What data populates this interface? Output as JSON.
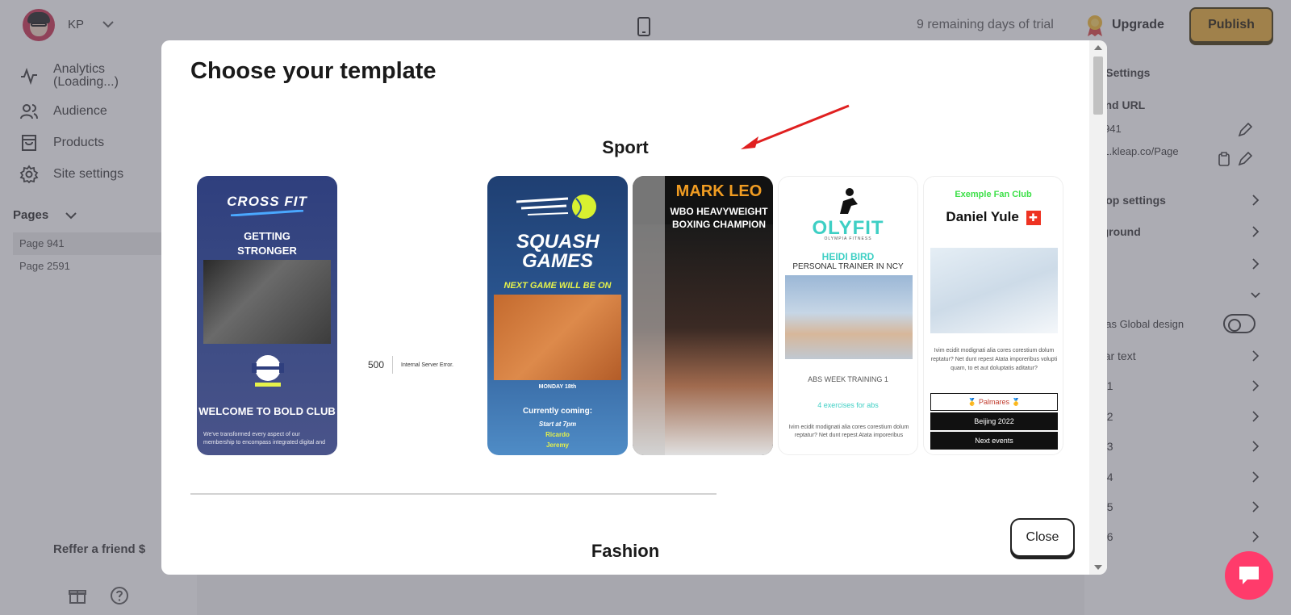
{
  "topbar": {
    "user_initials": "KP",
    "trial_text": "9 remaining days of trial",
    "upgrade_label": "Upgrade",
    "publish_label": "Publish"
  },
  "sidebar": {
    "items": [
      {
        "label": "Analytics\n(Loading...)",
        "icon": "analytics-icon"
      },
      {
        "label": "Audience",
        "icon": "audience-icon"
      },
      {
        "label": "Products",
        "icon": "products-icon"
      },
      {
        "label": "Site settings",
        "icon": "gear-icon"
      }
    ],
    "pages_heading": "Pages",
    "pages": [
      {
        "label": "Page 941",
        "active": true
      },
      {
        "label": "Page 2591",
        "active": false
      }
    ],
    "refer_label": "Reffer a friend $"
  },
  "right_panel": {
    "title": "ge Settings",
    "name_url_heading": "e and URL",
    "page_name": "ge 941",
    "page_url": "est1.kleap.co/Page",
    "rows": [
      {
        "label": "sktop settings"
      },
      {
        "label": "ckground"
      },
      {
        "label": "O"
      },
      {
        "label": "t"
      },
      {
        "label": "ply as Global design"
      },
      {
        "label": "gular text"
      },
      {
        "label": "e H1"
      },
      {
        "label": "e H2"
      },
      {
        "label": "e H3"
      },
      {
        "label": "e H4"
      },
      {
        "label": "e H5"
      },
      {
        "label": "e H6"
      }
    ]
  },
  "modal": {
    "title": "Choose your template",
    "sections": [
      {
        "title": "Sport"
      },
      {
        "title": "Fashion"
      }
    ],
    "close_label": "Close"
  },
  "templates": {
    "crossfit": {
      "logo": "CROSS FIT",
      "slogan": "GETTING STRONGER EVERY DAY !",
      "welcome": "WELCOME TO BOLD CLUB",
      "body": "We've transformed every aspect of our membership to encompass integrated digital and"
    },
    "error": {
      "code": "500",
      "message": "Internal Server Error."
    },
    "squash": {
      "title": "SQUASH GAMES",
      "next": "NEXT GAME WILL BE ON",
      "date": "MONDAY 18th",
      "coming": "Currently coming:",
      "start": "Start at 7pm",
      "name1": "Ricardo",
      "name2": "Jeremy"
    },
    "boxing": {
      "name": "MARK LEO",
      "subtitle": "WBO HEAVYWEIGHT BOXING CHAMPION"
    },
    "olyfit": {
      "logo": "OLYFIT",
      "logo_sub": "OLYMPIA FITNESS",
      "name": "HEIDI BIRD",
      "role": "PERSONAL TRAINER IN NCY",
      "abs": "ABS WEEK TRAINING 1",
      "exercises": "4 exercises for abs",
      "body": "Ivim ecidit modignati alia cores corestium dolum reptatur? Net dunt repest Atata imporeribus"
    },
    "fanclub": {
      "club": "Exemple Fan Club",
      "name": "Daniel Yule",
      "flag": "✚",
      "body": "Ivim ecidit modignati alia cores corestium dolum reptatur? Net dunt repest Atata imporeribus volupti quam, to et aut doluptatis aditatur?",
      "palmares": "🥇 Palmares 🥇",
      "beijing": "Beijing 2022",
      "next_events": "Next events"
    }
  },
  "colors": {
    "publish_bg": "#e7a92f",
    "chat_bg": "#ff3b6b",
    "annotation_arrow": "#e02020"
  }
}
